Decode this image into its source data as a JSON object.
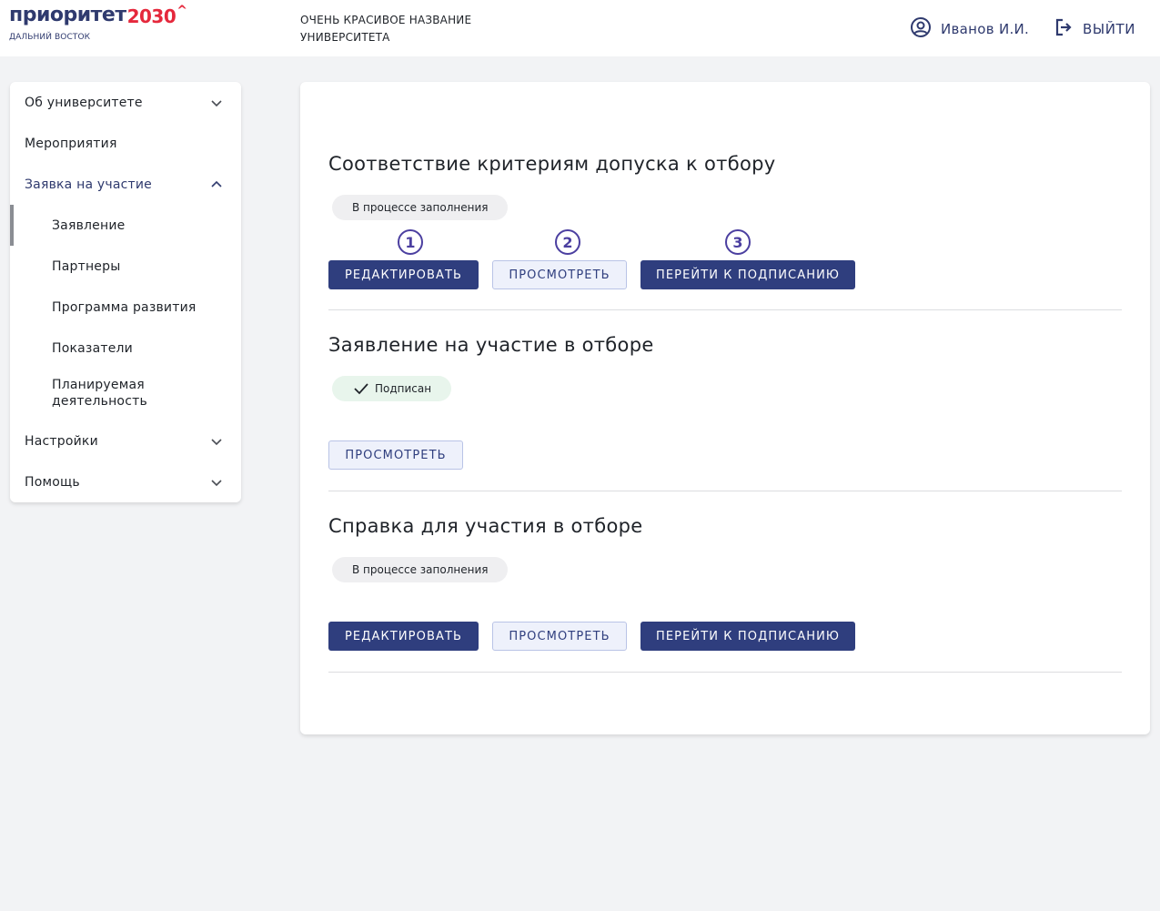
{
  "header": {
    "logo_word": "приоритет",
    "logo_number": "2030",
    "logo_caret": "^",
    "logo_sub": "ДАЛЬНИЙ ВОСТОК",
    "university_name": "ОЧЕНЬ КРАСИВОЕ НАЗВАНИЕ УНИВЕРСИТЕТА",
    "user_name": "Иванов И.И.",
    "logout_label": "ВЫЙТИ"
  },
  "sidebar": {
    "items": [
      {
        "label": "Об университете"
      },
      {
        "label": "Мероприятия"
      },
      {
        "label": "Заявка на участие"
      },
      {
        "label": "Заявление"
      },
      {
        "label": "Партнеры"
      },
      {
        "label": "Программа развития"
      },
      {
        "label": "Показатели"
      },
      {
        "label": "Планируемая деятельность"
      },
      {
        "label": "Настройки"
      },
      {
        "label": "Помощь"
      }
    ]
  },
  "main": {
    "sections": [
      {
        "title": "Соответствие критериям допуска к отбору",
        "status": "В процессе заполнения",
        "edit_label": "РЕДАКТИРОВАТЬ",
        "view_label": "ПРОСМОТРЕТЬ",
        "sign_label": "ПЕРЕЙТИ К ПОДПИСАНИЮ"
      },
      {
        "title": "Заявление на участие в отборе",
        "status": "Подписан",
        "view_label": "ПРОСМОТРЕТЬ"
      },
      {
        "title": "Справка для участия в отборе",
        "status": "В процессе заполнения",
        "edit_label": "РЕДАКТИРОВАТЬ",
        "view_label": "ПРОСМОТРЕТЬ",
        "sign_label": "ПЕРЕЙТИ К ПОДПИСАНИЮ"
      }
    ],
    "step_markers": [
      "1",
      "2",
      "3"
    ]
  },
  "colors": {
    "brand": "#2f3a6e",
    "accent_red": "#e5283c",
    "primary_button": "#2f3e7e",
    "marker": "#4b3fa0",
    "signed_badge": "#e8f5ec"
  }
}
